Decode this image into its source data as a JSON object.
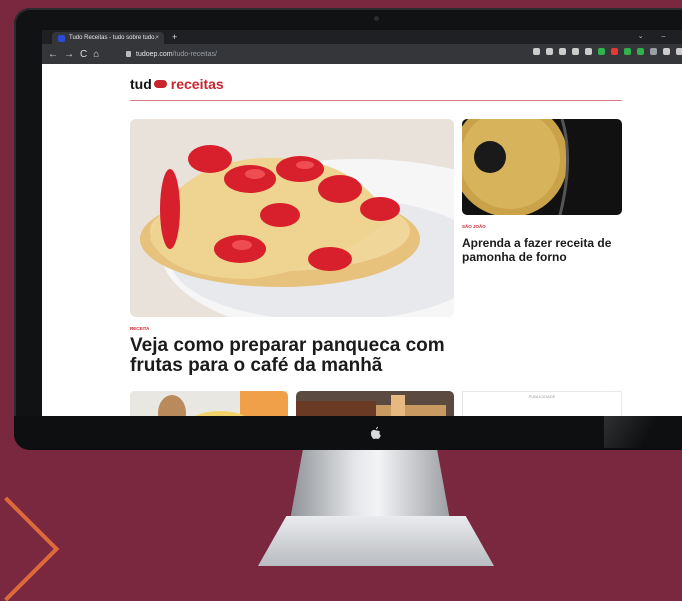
{
  "browser": {
    "tab_title": "Tudo Receitas - tudo sobre tudo.",
    "tab_close": "×",
    "new_tab": "+",
    "window_controls": "⌄ – ▢",
    "nav_back": "←",
    "nav_forward": "→",
    "nav_reload": "C",
    "nav_home": "⌂",
    "url_domain": "tudoep.com",
    "url_path": "/tudo-receitas/",
    "extension_colors": [
      "#cccccc",
      "#cccccc",
      "#cccccc",
      "#cccccc",
      "#cccccc",
      "#2fb34a",
      "#e53935",
      "#2fb34a",
      "#2fb34a",
      "#9aa0a6",
      "#cccccc",
      "#cccccc",
      "#f2a33a"
    ]
  },
  "site": {
    "logo_left": "tud",
    "logo_right": "receitas",
    "brand_color": "#c8252f"
  },
  "hero": {
    "category": "RECEITA",
    "headline": "Veja como preparar panqueca com frutas para o café da manhã"
  },
  "side_story": {
    "category": "SÃO JOÃO",
    "headline": "Aprenda a fazer receita de pamonha de forno"
  },
  "ad": {
    "label": "PUBLICIDADE"
  }
}
